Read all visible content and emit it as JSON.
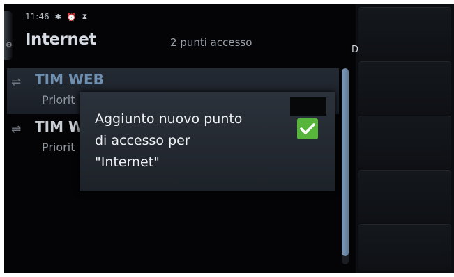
{
  "status_bar": {
    "time": "11:46",
    "icons": [
      "bluetooth-icon",
      "alarm-icon",
      "hourglass-icon"
    ]
  },
  "header": {
    "title": "Internet",
    "subtitle": "2 punti accesso"
  },
  "list": {
    "items": [
      {
        "title": "TIM WEB",
        "subtitle": "Priorit",
        "icon": "arrows-icon",
        "selected": true
      },
      {
        "title": "TIM W",
        "subtitle": "Priorit",
        "icon": "arrows-icon",
        "selected": false
      }
    ]
  },
  "dialog": {
    "message": "Aggiunto nuovo punto\ndi accesso per\n\"Internet\"",
    "icon": "checkmark-icon",
    "icon_color": "#58b53c"
  },
  "right_panel": {
    "edge_label": "D"
  },
  "colors": {
    "background": "#040406",
    "selected_title": "#6f8fb0",
    "scroll_thumb": "#6f8aa8"
  }
}
